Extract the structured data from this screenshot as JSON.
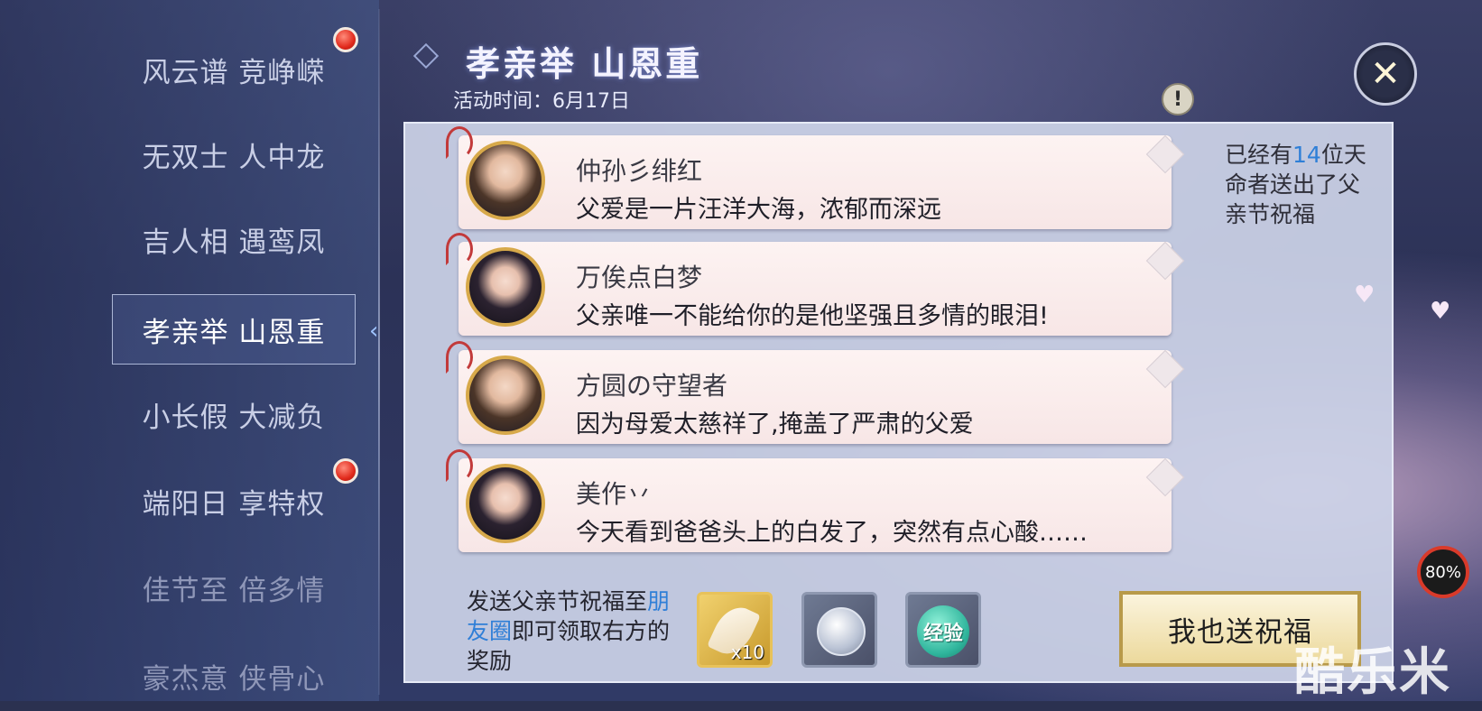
{
  "sidebar": {
    "items": [
      {
        "label": "风云谱 竞峥嵘",
        "badge": true
      },
      {
        "label": "无双士 人中龙",
        "badge": false
      },
      {
        "label": "吉人相 遇鸾凤",
        "badge": false
      },
      {
        "label": "孝亲举 山恩重",
        "badge": false,
        "active": true
      },
      {
        "label": "小长假 大减负",
        "badge": false
      },
      {
        "label": "端阳日 享特权",
        "badge": true
      },
      {
        "label": "佳节至 倍多情",
        "badge": false
      },
      {
        "label": "豪杰意 侠骨心",
        "badge": false
      }
    ]
  },
  "header": {
    "title": "孝亲举 山恩重",
    "time": "活动时间：6月17日",
    "info_icon": "info-icon",
    "close_icon": "close-icon"
  },
  "messages": [
    {
      "name": "仲孙彡绯红",
      "text": "父爱是一片汪洋大海，浓郁而深远",
      "avatar": "male-avatar"
    },
    {
      "name": "万俟点白梦",
      "text": "父亲唯一不能给你的是他坚强且多情的眼泪!",
      "avatar": "female-avatar"
    },
    {
      "name": "方圆の守望者",
      "text": "因为母爱太慈祥了,掩盖了严肃的父爱",
      "avatar": "male-avatar"
    },
    {
      "name": "美作丷",
      "text": "今天看到爸爸头上的白发了，突然有点心酸……",
      "avatar": "female-avatar"
    }
  ],
  "side_note": {
    "prefix": "已经有",
    "count": "14",
    "suffix": "位天命者送出了父亲节祝福"
  },
  "reward": {
    "text_a": "发送父亲节祝福至",
    "link": "朋友圈",
    "text_b": "即可领取右方的奖励",
    "items": [
      {
        "icon": "feather-icon",
        "qty": "x10"
      },
      {
        "icon": "silver-coin-icon"
      },
      {
        "icon": "exp-icon",
        "label": "经验"
      }
    ]
  },
  "send_button": "我也送祝福",
  "overlay": {
    "cpu_text": "80%",
    "watermark": "酷乐米"
  }
}
